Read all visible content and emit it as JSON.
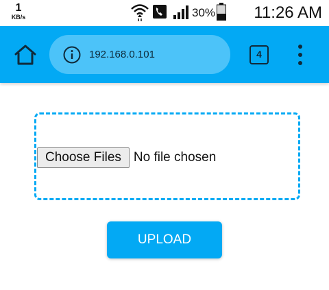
{
  "status_bar": {
    "net_speed_value": "1",
    "net_speed_unit": "KB/s",
    "battery_percent": "30%",
    "time": "11:26 AM",
    "icons": [
      "wifi-icon",
      "call-icon",
      "signal-icon",
      "battery-icon"
    ]
  },
  "browser": {
    "url": "192.168.0.101",
    "tab_count": "4",
    "accent_color": "#03a9f4",
    "icons": [
      "home-icon",
      "info-icon",
      "tabs-icon",
      "overflow-menu-icon"
    ]
  },
  "page": {
    "choose_files_label": "Choose Files",
    "file_status": "No file chosen",
    "upload_label": "UPLOAD"
  }
}
